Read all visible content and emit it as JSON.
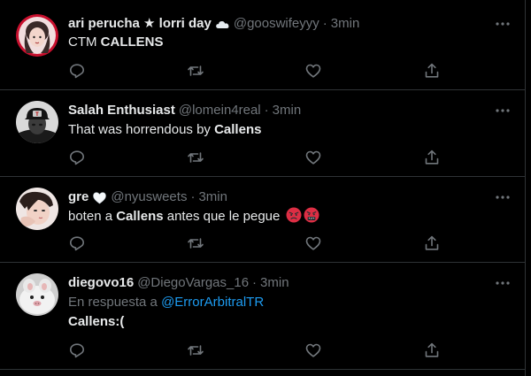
{
  "colors": {
    "background": "#000000",
    "text": "#e7e9ea",
    "secondary": "#71767b",
    "divider": "#2f3336",
    "link": "#1d9bf0"
  },
  "tweets": [
    {
      "display_name": "ari perucha ★ lorri day",
      "badge_icon": "cloud-emoji",
      "handle": "@gooswifeyyy",
      "separator": "·",
      "time": "3min",
      "text_before": "CTM ",
      "text_bold": "CALLENS",
      "text_after": ""
    },
    {
      "display_name": "Salah Enthusiast",
      "handle": "@lomein4real",
      "separator": "·",
      "time": "3min",
      "text_before": "That was horrendous by ",
      "text_bold": "Callens",
      "text_after": ""
    },
    {
      "display_name": "gre",
      "badge_icon": "white-heart-emoji",
      "handle": "@nyusweets",
      "separator": "·",
      "time": "3min",
      "text_before": "boten a ",
      "text_bold": "Callens",
      "text_after": " antes que le pegue ",
      "emojis": [
        "angry-face-emoji",
        "cursing-face-emoji"
      ]
    },
    {
      "display_name": "diegovo16",
      "handle": "@DiegoVargas_16",
      "separator": "·",
      "time": "3min",
      "reply_prefix": "En respuesta a ",
      "reply_mention": "@ErrorArbitralTR",
      "text_before": "",
      "text_bold": "Callens:(",
      "text_after": ""
    }
  ],
  "action_icons": [
    "reply-icon",
    "retweet-icon",
    "like-icon",
    "share-icon"
  ]
}
